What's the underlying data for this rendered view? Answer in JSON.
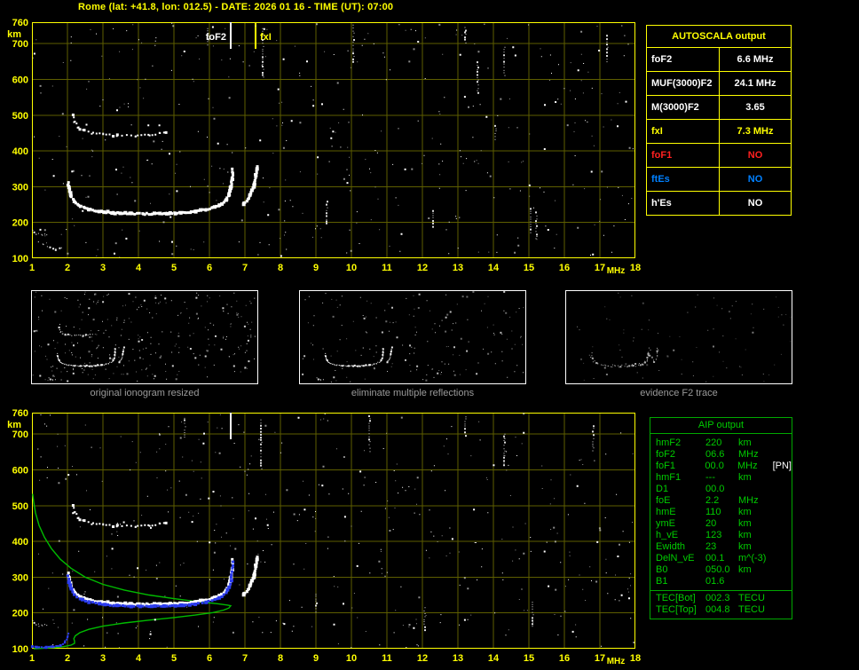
{
  "header": {
    "title": "Rome (lat: +41.8, lon: 012.5) - DATE: 2026 01 16 - TIME (UT): 07:00"
  },
  "autoscala": {
    "title": "AUTOSCALA output",
    "rows": [
      {
        "label": "foF2",
        "value": "6.6 MHz",
        "color": "#ffffff"
      },
      {
        "label": "MUF(3000)F2",
        "value": "24.1 MHz",
        "color": "#ffffff"
      },
      {
        "label": "M(3000)F2",
        "value": "3.65",
        "color": "#ffffff"
      },
      {
        "label": "fxI",
        "value": "7.3 MHz",
        "color": "#ffff00"
      },
      {
        "label": "foF1",
        "value": "NO",
        "color": "#ff2020"
      },
      {
        "label": "ftEs",
        "value": "NO",
        "color": "#0080ff"
      },
      {
        "label": "h'Es",
        "value": "NO",
        "color": "#ffffff"
      }
    ]
  },
  "aip": {
    "title": "AIP output",
    "rows": [
      {
        "name": "hmF2",
        "value": "220",
        "unit": "km"
      },
      {
        "name": "foF2",
        "value": "06.6",
        "unit": "MHz"
      },
      {
        "name": "foF1",
        "value": "00.0",
        "unit": "MHz",
        "extra": "[PN]"
      },
      {
        "name": "hmF1",
        "value": "---",
        "unit": "km"
      },
      {
        "name": "D1",
        "value": "00.0",
        "unit": ""
      },
      {
        "name": "foE",
        "value": "2.2",
        "unit": "MHz"
      },
      {
        "name": "hmE",
        "value": "110",
        "unit": "km"
      },
      {
        "name": "ymE",
        "value": "20",
        "unit": "km"
      },
      {
        "name": "h_vE",
        "value": "123",
        "unit": "km"
      },
      {
        "name": "Ewidth",
        "value": "23",
        "unit": "km"
      },
      {
        "name": "DelN_vE",
        "value": "00.1",
        "unit": "m^(-3)"
      },
      {
        "name": "B0",
        "value": "050.0",
        "unit": "km"
      },
      {
        "name": "B1",
        "value": "01.6",
        "unit": ""
      }
    ],
    "tec_rows": [
      {
        "name": "TEC[Bot]",
        "value": "002.3",
        "unit": "TECU"
      },
      {
        "name": "TEC[Top]",
        "value": "004.8",
        "unit": "TECU"
      }
    ]
  },
  "panels": [
    {
      "caption": "original ionogram resized"
    },
    {
      "caption": "eliminate multiple reflections"
    },
    {
      "caption": "evidence F2 trace"
    }
  ],
  "chart_data": {
    "type": "scatter",
    "title": "Ionogram, Rome, 2026-01-16 07:00 UT",
    "axes": {
      "xlabel": "MHz",
      "ylabel": "km",
      "xlim": [
        1,
        18
      ],
      "ylim": [
        100,
        760
      ],
      "x_ticks": [
        1,
        2,
        3,
        4,
        5,
        6,
        7,
        8,
        9,
        10,
        11,
        12,
        13,
        14,
        15,
        16,
        17,
        18
      ],
      "y_ticks": [
        760,
        700,
        600,
        500,
        400,
        300,
        200,
        100
      ],
      "grid_color": "#5e5e00"
    },
    "trace_points": {
      "f2_ordinary": [
        [
          2.02,
          310
        ],
        [
          2.05,
          292
        ],
        [
          2.1,
          274
        ],
        [
          2.2,
          257
        ],
        [
          2.35,
          246
        ],
        [
          2.6,
          237
        ],
        [
          2.9,
          231
        ],
        [
          3.3,
          227
        ],
        [
          3.8,
          225
        ],
        [
          4.3,
          224
        ],
        [
          4.8,
          225
        ],
        [
          5.2,
          227
        ],
        [
          5.6,
          231
        ],
        [
          5.9,
          236
        ],
        [
          6.15,
          243
        ],
        [
          6.35,
          252
        ],
        [
          6.48,
          263
        ],
        [
          6.56,
          277
        ],
        [
          6.61,
          296
        ],
        [
          6.64,
          322
        ],
        [
          6.66,
          348
        ]
      ],
      "f2_extraordinary": [
        [
          6.95,
          250
        ],
        [
          7.05,
          261
        ],
        [
          7.15,
          277
        ],
        [
          7.24,
          299
        ],
        [
          7.3,
          329
        ],
        [
          7.33,
          356
        ]
      ],
      "second_order": [
        [
          2.15,
          502
        ],
        [
          2.2,
          482
        ],
        [
          2.3,
          467
        ],
        [
          2.45,
          457
        ],
        [
          2.7,
          450
        ],
        [
          3.0,
          446
        ],
        [
          3.4,
          443
        ],
        [
          3.9,
          442
        ],
        [
          4.3,
          444
        ],
        [
          4.6,
          448
        ],
        [
          4.8,
          453
        ]
      ],
      "e_region_a": [
        [
          1.02,
          176
        ],
        [
          1.14,
          169
        ],
        [
          1.28,
          165
        ],
        [
          1.4,
          168
        ]
      ],
      "e_region_b": [
        [
          1.35,
          136
        ],
        [
          1.5,
          129
        ],
        [
          1.68,
          125
        ],
        [
          1.85,
          128
        ]
      ],
      "profile_green": [
        [
          1.02,
          533
        ],
        [
          1.05,
          510
        ],
        [
          1.1,
          480
        ],
        [
          1.2,
          445
        ],
        [
          1.35,
          412
        ],
        [
          1.55,
          380
        ],
        [
          1.8,
          350
        ],
        [
          2.1,
          325
        ],
        [
          2.5,
          300
        ],
        [
          3.0,
          280
        ],
        [
          3.6,
          264
        ],
        [
          4.3,
          250
        ],
        [
          5.0,
          240
        ],
        [
          5.7,
          231
        ],
        [
          6.2,
          226
        ],
        [
          6.5,
          222
        ],
        [
          6.6,
          220
        ],
        [
          6.55,
          214
        ],
        [
          6.4,
          208
        ],
        [
          6.1,
          201
        ],
        [
          5.6,
          194
        ],
        [
          5.0,
          187
        ],
        [
          4.3,
          180
        ],
        [
          3.6,
          172
        ],
        [
          3.0,
          163
        ],
        [
          2.6,
          154
        ],
        [
          2.35,
          145
        ],
        [
          2.22,
          136
        ],
        [
          2.18,
          128
        ],
        [
          2.2,
          121
        ],
        [
          2.2,
          115
        ],
        [
          2.1,
          110
        ],
        [
          1.9,
          106
        ],
        [
          1.6,
          103
        ],
        [
          1.3,
          101
        ],
        [
          1.05,
          100
        ]
      ],
      "e_trace_blue": [
        [
          1.02,
          107
        ],
        [
          1.2,
          105
        ],
        [
          1.4,
          104
        ],
        [
          1.62,
          105
        ],
        [
          1.8,
          109
        ],
        [
          1.92,
          117
        ],
        [
          1.99,
          131
        ],
        [
          2.02,
          142
        ]
      ]
    },
    "plots": [
      {
        "id": "top",
        "border": "#ffff00",
        "grid": true,
        "axis_labels": true,
        "xlim": [
          1,
          18
        ],
        "ylim": [
          100,
          760
        ],
        "markers": [
          {
            "label": "foF2",
            "freq": 6.6,
            "color": "#ffffff",
            "side": "left"
          },
          {
            "label": "fxI",
            "freq": 7.3,
            "color": "#ffff00",
            "side": "right"
          }
        ],
        "traces": [
          {
            "ref": "f2_ordinary",
            "color": "#ffffff",
            "size": 3,
            "step": 2,
            "jitter": 0.8,
            "seed": 3
          },
          {
            "ref": "f2_extraordinary",
            "color": "#ffffff",
            "size": 3,
            "step": 2,
            "jitter": 0.8,
            "seed": 4
          },
          {
            "ref": "second_order",
            "color": "#ffffff",
            "size": 2,
            "step": 4.5,
            "jitter": 1,
            "seed": 5
          },
          {
            "ref": "e_region_a",
            "color": "#e8e8e8",
            "size": 1,
            "step": 3,
            "jitter": 1,
            "seed": 6
          },
          {
            "ref": "e_region_b",
            "color": "#e8e8e8",
            "size": 1,
            "step": 3,
            "jitter": 1,
            "seed": 7
          }
        ],
        "noise": {
          "count": 430,
          "seed": 11,
          "color": "#ffffff"
        },
        "streaks": [
          [
            5.95,
            690,
            742
          ],
          [
            7.5,
            598,
            742
          ],
          [
            9.3,
            196,
            258
          ],
          [
            10.05,
            642,
            752
          ],
          [
            12.3,
            186,
            232
          ],
          [
            13.2,
            700,
            745
          ],
          [
            13.55,
            556,
            648
          ],
          [
            14.05,
            428,
            470
          ],
          [
            14.3,
            608,
            690
          ],
          [
            15.05,
            168,
            238
          ],
          [
            15.2,
            152,
            228
          ],
          [
            17.2,
            648,
            722
          ]
        ]
      },
      {
        "id": "bottom",
        "border": "#ffff00",
        "grid": true,
        "axis_labels": true,
        "xlim": [
          1,
          18
        ],
        "ylim": [
          100,
          760
        ],
        "markers": [
          {
            "freq": 6.6,
            "color": "#ffffff"
          }
        ],
        "traces": [
          {
            "ref": "f2_ordinary",
            "color": "#ffffff",
            "size": 3,
            "step": 2,
            "jitter": 0.8,
            "seed": 3
          },
          {
            "ref": "f2_extraordinary",
            "color": "#ffffff",
            "size": 3,
            "step": 2,
            "jitter": 0.8,
            "seed": 4
          },
          {
            "ref": "second_order",
            "color": "#ffffff",
            "size": 2,
            "step": 4.5,
            "jitter": 1,
            "seed": 5
          },
          {
            "ref": "e_region_a",
            "color": "#e8e8e8",
            "size": 1,
            "step": 3,
            "jitter": 1,
            "seed": 6
          },
          {
            "ref": "f2_ordinary",
            "color": "#2b3cee",
            "size": 3,
            "step": 3.5,
            "jitter": 0.5,
            "seed": 8,
            "dy_km": -6
          },
          {
            "ref": "e_trace_blue",
            "color": "#2b3cee",
            "size": 2,
            "step": 2.5,
            "jitter": 0.6,
            "seed": 9
          },
          {
            "ref": "profile_green",
            "color": "#00bb00",
            "line": true,
            "width": 1.4
          }
        ],
        "noise": {
          "count": 430,
          "seed": 29,
          "color": "#ffffff"
        },
        "streaks": [
          [
            5.3,
            688,
            744
          ],
          [
            7.45,
            600,
            740
          ],
          [
            9.0,
            198,
            252
          ],
          [
            10.5,
            645,
            750
          ],
          [
            12.05,
            148,
            215
          ],
          [
            13.2,
            695,
            748
          ],
          [
            14.3,
            610,
            700
          ],
          [
            15.1,
            158,
            230
          ],
          [
            16.8,
            652,
            722
          ]
        ]
      },
      {
        "id": "panel1",
        "grid": false,
        "axis_labels": false,
        "xlim": [
          0,
          18
        ],
        "ylim": [
          100,
          760
        ],
        "traces": [
          {
            "ref": "f2_ordinary",
            "color": "#f0f0f0",
            "size": 1,
            "step": 1.3,
            "jitter": 0.5,
            "seed": 3
          },
          {
            "ref": "f2_extraordinary",
            "color": "#f0f0f0",
            "size": 1,
            "step": 1.5,
            "jitter": 0.5,
            "seed": 4
          },
          {
            "ref": "second_order",
            "color": "#e0e0e0",
            "size": 1,
            "step": 2.5,
            "jitter": 0.6,
            "seed": 5
          },
          {
            "ref": "e_region_b",
            "color": "#d0d0d0",
            "size": 1,
            "step": 2.5,
            "jitter": 0.6,
            "seed": 6
          }
        ],
        "noise": {
          "count": 300,
          "seed": 41,
          "color": "#cccccc"
        }
      },
      {
        "id": "panel2",
        "grid": false,
        "axis_labels": false,
        "xlim": [
          0,
          18
        ],
        "ylim": [
          100,
          760
        ],
        "traces": [
          {
            "ref": "f2_ordinary",
            "color": "#f0f0f0",
            "size": 1,
            "step": 1.3,
            "jitter": 0.5,
            "seed": 3
          },
          {
            "ref": "f2_extraordinary",
            "color": "#f0f0f0",
            "size": 1,
            "step": 1.5,
            "jitter": 0.5,
            "seed": 4
          },
          {
            "ref": "e_region_b",
            "color": "#d0d0d0",
            "size": 1,
            "step": 2.5,
            "jitter": 0.6,
            "seed": 6
          }
        ],
        "noise": {
          "count": 170,
          "seed": 42,
          "color": "#bbbbbb"
        }
      },
      {
        "id": "panel3",
        "grid": false,
        "axis_labels": false,
        "xlim": [
          0,
          18
        ],
        "ylim": [
          100,
          760
        ],
        "traces": [
          {
            "ref": "f2_ordinary",
            "color": "#a8a8a8",
            "size": 1,
            "step": 2.2,
            "jitter": 1.4,
            "seed": 3
          },
          {
            "ref": "f2_extraordinary",
            "color": "#a8a8a8",
            "size": 1,
            "step": 2.5,
            "jitter": 1.2,
            "seed": 4
          }
        ],
        "noise": {
          "count": 90,
          "seed": 43,
          "color": "#7a7a7a"
        }
      }
    ]
  }
}
